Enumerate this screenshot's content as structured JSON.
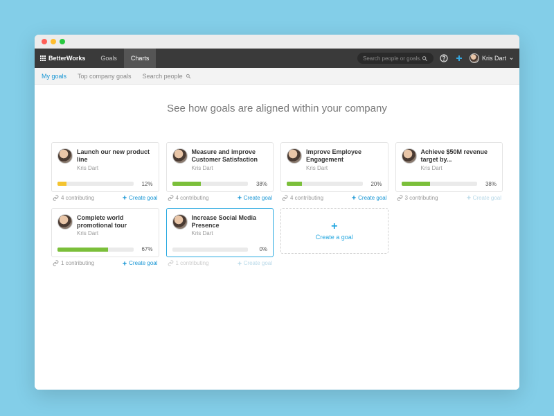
{
  "brand": "BetterWorks",
  "nav": {
    "tabs": [
      "Goals",
      "Charts"
    ],
    "active": 1
  },
  "search": {
    "placeholder": "Search people or goals..."
  },
  "user": {
    "name": "Kris Dart"
  },
  "subnav": {
    "items": [
      "My goals",
      "Top company goals"
    ],
    "active": 0,
    "search_label": "Search people"
  },
  "headline": "See how goals are aligned within your company",
  "labels": {
    "contributing_suffix": " contributing",
    "create_goal": "Create goal",
    "create_a_goal": "Create a goal"
  },
  "goals": [
    {
      "title": "Launch our new product line",
      "owner": "Kris Dart",
      "progress": 12,
      "color": "#f4c430",
      "contributing": 4,
      "selected": false,
      "create_disabled": false
    },
    {
      "title": "Measure and improve Customer Satisfaction",
      "owner": "Kris Dart",
      "progress": 38,
      "color": "#7bbf3a",
      "contributing": 4,
      "selected": false,
      "create_disabled": false
    },
    {
      "title": "Improve Employee Engagement",
      "owner": "Kris Dart",
      "progress": 20,
      "color": "#7bbf3a",
      "contributing": 4,
      "selected": false,
      "create_disabled": false
    },
    {
      "title": "Achieve $50M revenue target by...",
      "owner": "Kris Dart",
      "progress": 38,
      "color": "#7bbf3a",
      "contributing": 3,
      "selected": false,
      "create_disabled": true
    },
    {
      "title": "Complete world promotional tour",
      "owner": "Kris Dart",
      "progress": 67,
      "color": "#7bbf3a",
      "contributing": 1,
      "selected": false,
      "create_disabled": false
    },
    {
      "title": "Increase Social Media Presence",
      "owner": "Kris Dart",
      "progress": 0,
      "color": "#7bbf3a",
      "contributing": 1,
      "selected": true,
      "create_disabled": true
    }
  ]
}
